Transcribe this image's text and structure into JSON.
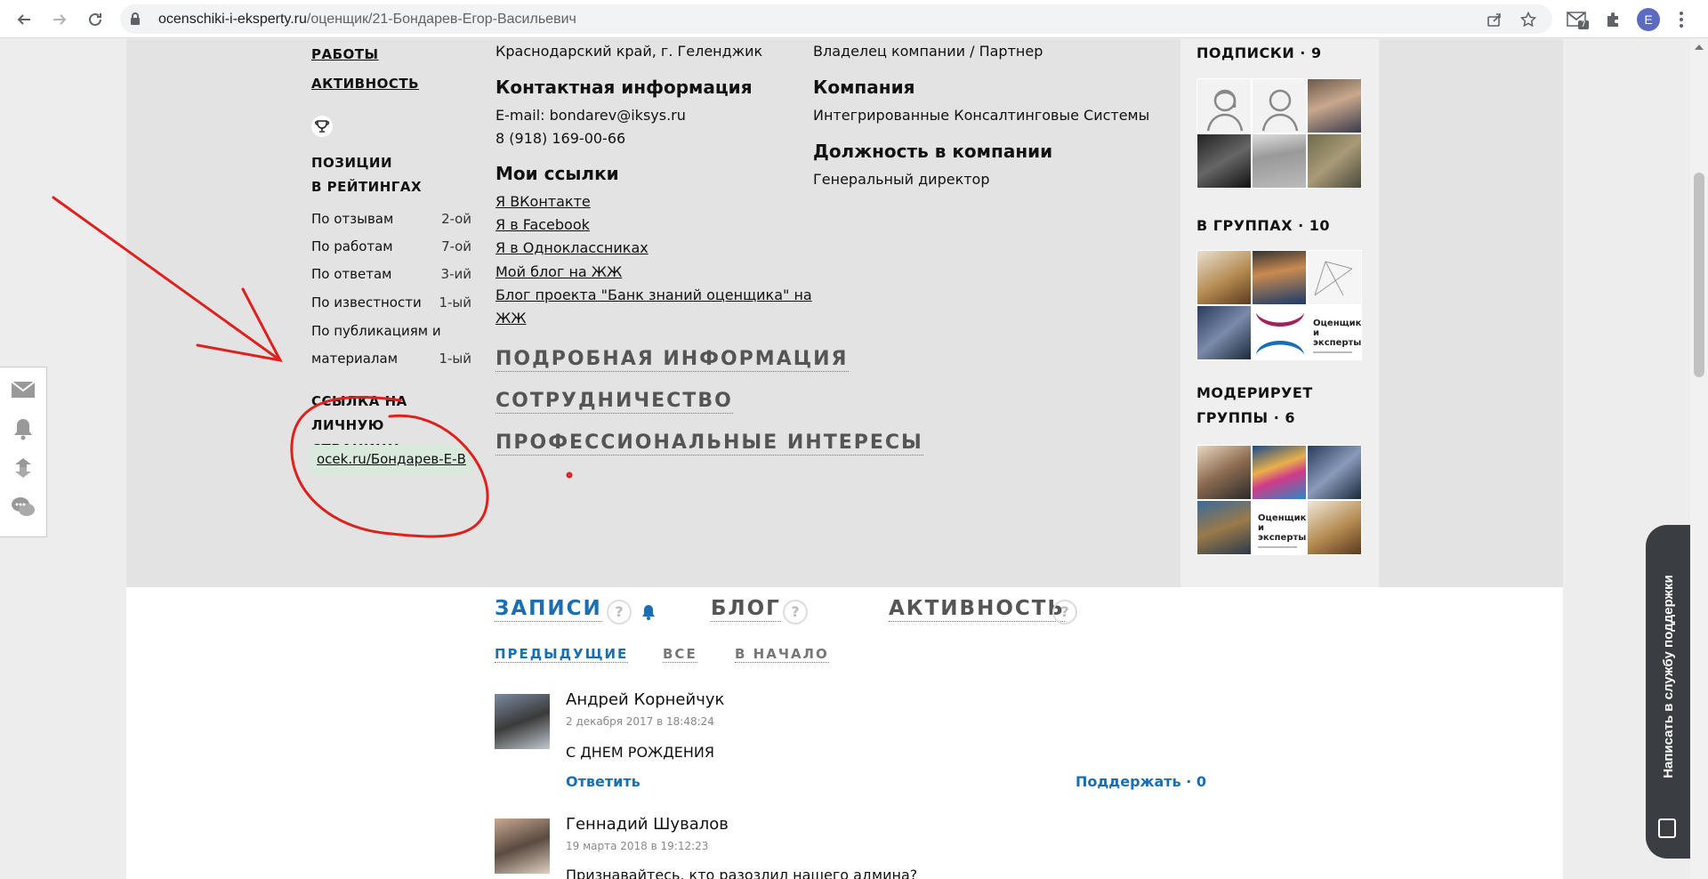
{
  "browser": {
    "url_host": "ocenschiki-i-eksperty.ru",
    "url_path": "/оценщик/21-Бондарев-Егор-Васильевич",
    "profile_initial": "E",
    "ext_badge": "7"
  },
  "left": {
    "link_works": "РАБОТЫ",
    "link_activity": "АКТИВНОСТЬ",
    "ratings_heading_1": "ПОЗИЦИИ",
    "ratings_heading_2": "В РЕЙТИНГАХ",
    "ratings": [
      {
        "label": "По отзывам",
        "pos": "2-ой"
      },
      {
        "label": "По работам",
        "pos": "7-ой"
      },
      {
        "label": "По ответам",
        "pos": "3-ий"
      },
      {
        "label": "По известности",
        "pos": "1-ый"
      },
      {
        "label": "По публикациям и",
        "pos": ""
      },
      {
        "label": "материалам",
        "pos": "1-ый"
      }
    ],
    "page_link_heading_1": "ССЫЛКА НА",
    "page_link_heading_2": "ЛИЧНУЮ СТРАНИЦУ",
    "page_link": "ocek.ru/Бондарев-Е-В"
  },
  "contact": {
    "region": "Краснодарский край, г. Геленджик",
    "heading": "Контактная информация",
    "email": "E-mail: bondarev@iksys.ru",
    "phone": "8 (918) 169-00-66",
    "links_heading": "Мои ссылки",
    "links": [
      "Я ВКонтакте",
      "Я в Facebook",
      "Я в Одноклассниках",
      "Мой блог на ЖЖ",
      "Блог проекта \"Банк знаний оценщика\" на",
      "ЖЖ"
    ]
  },
  "company": {
    "role": "Владелец компании / Партнер",
    "heading": "Компания",
    "name": "Интегрированные Консалтинговые Системы",
    "position_heading": "Должность в компании",
    "position": "Генеральный директор"
  },
  "sections": {
    "detail": "ПОДРОБНАЯ ИНФОРМАЦИЯ",
    "cooperation": "СОТРУДНИЧЕСТВО",
    "interests": "ПРОФЕССИОНАЛЬНЫЕ ИНТЕРЕСЫ"
  },
  "sidebar": {
    "subscriptions": "ПОДПИСКИ · 9",
    "groups": "В ГРУППАХ · 10",
    "moderates_1": "МОДЕРИРУЕТ",
    "moderates_2": "ГРУППЫ · 6",
    "group_logo_line1": "Оценщики",
    "group_logo_line2": "и эксперты"
  },
  "tabs": {
    "posts": "ЗАПИСИ",
    "blog": "БЛОГ",
    "activity": "АКТИВНОСТЬ",
    "help": "?",
    "prev": "ПРЕДЫДУЩИЕ",
    "all": "ВСЕ",
    "start": "В НАЧАЛО"
  },
  "posts": [
    {
      "author": "Андрей Корнейчук",
      "date": "2 декабря 2017 в 18:48:24",
      "text": "С ДНЕМ РОЖДЕНИЯ",
      "reply": "Ответить",
      "support": "Поддержать · 0"
    },
    {
      "author": "Геннадий Шувалов",
      "date": "19 марта 2018 в 19:12:23",
      "text": "Признавайтесь, кто разозлил нашего админа?"
    }
  ],
  "support_tab": "Написать в службу поддержки",
  "colors": {
    "accent": "#1a6fb3",
    "annotation": "#e0201c",
    "page_link_bg": "#d9eadd"
  }
}
